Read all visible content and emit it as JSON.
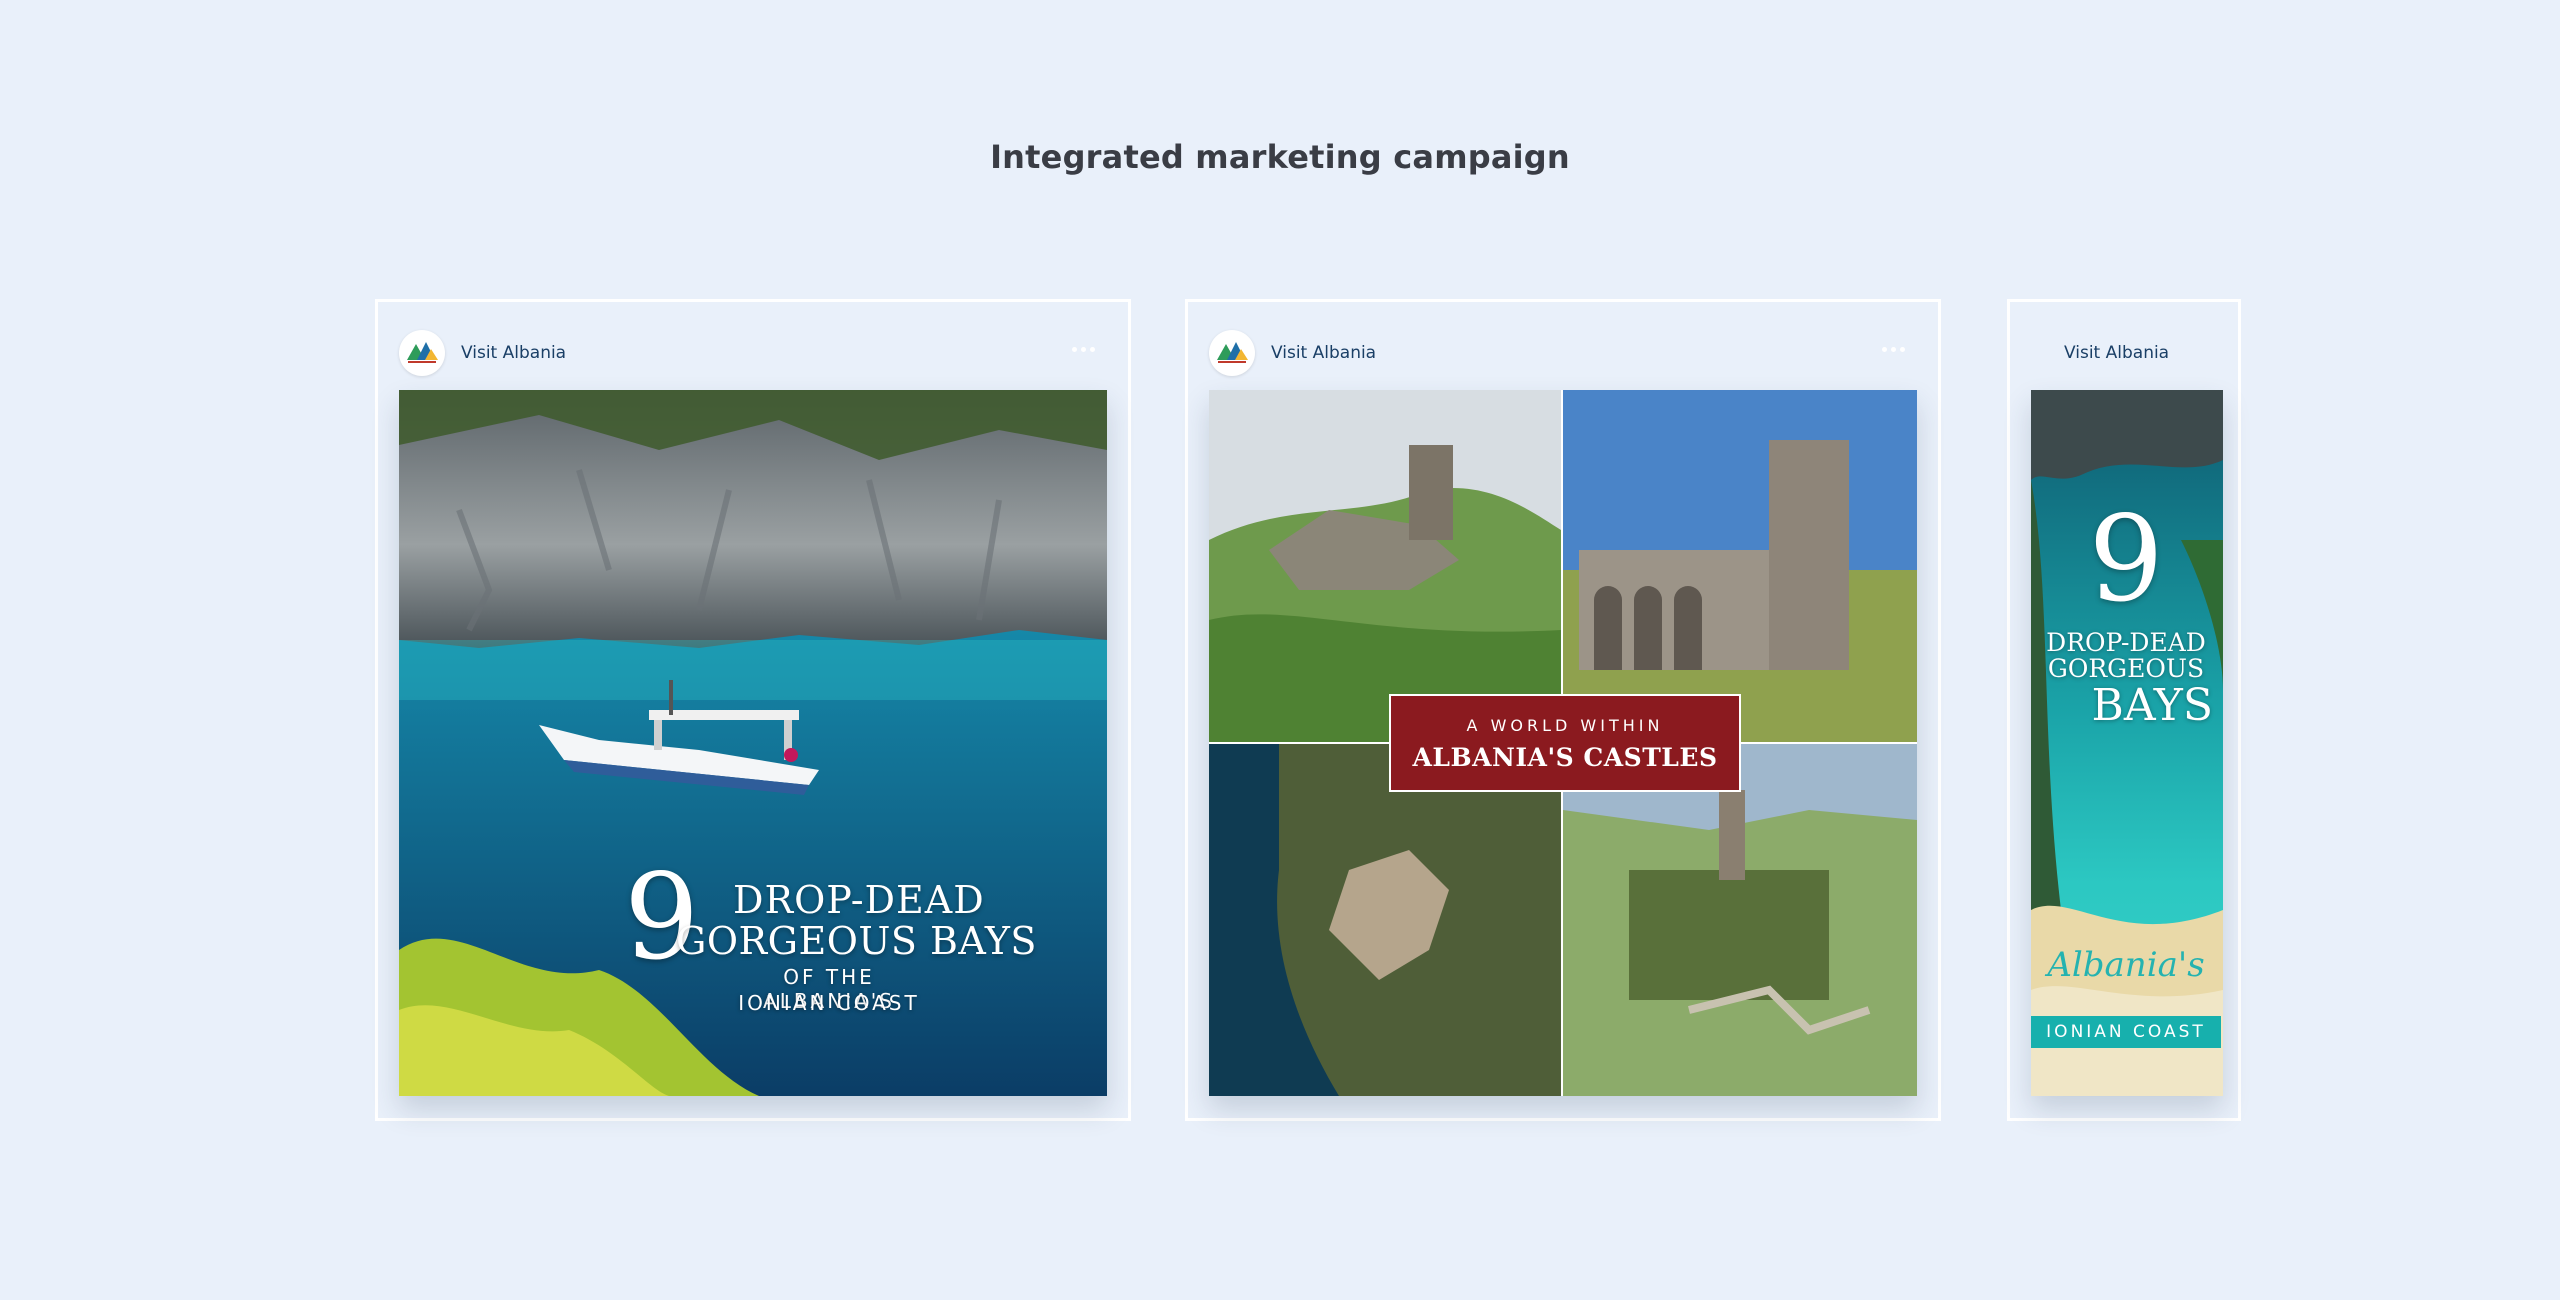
{
  "page": {
    "title": "Integrated marketing campaign"
  },
  "posts": [
    {
      "account": "Visit Albania",
      "avatar_icon": "visit-albania-logo",
      "headline": {
        "number": "9",
        "line1": "DROP-DEAD",
        "line2": "GORGEOUS BAYS",
        "line3": "OF THE ALBANIA'S",
        "line4": "IONIAN COAST"
      }
    },
    {
      "account": "Visit Albania",
      "avatar_icon": "visit-albania-logo",
      "banner": {
        "kicker": "A WORLD WITHIN",
        "title": "ALBANIA'S CASTLES",
        "color": "#8b1a1f"
      }
    },
    {
      "account": "Visit Albania",
      "headline": {
        "number": "9",
        "line1": "DROP-DEAD",
        "line2": "GORGEOUS",
        "line3": "BAYS",
        "script": "Albania's",
        "band": "IONIAN COAST",
        "band_color": "#17b0ad"
      }
    }
  ],
  "icons": {
    "more": "more-horizontal-icon"
  },
  "colors": {
    "background": "#e9f0fa",
    "account_text": "#1a3f66",
    "title_text": "#3a3d45"
  }
}
